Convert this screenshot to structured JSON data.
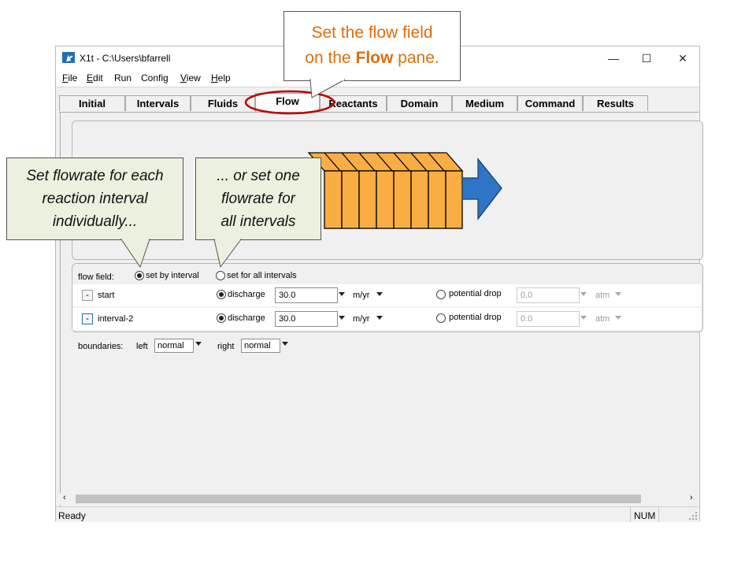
{
  "window": {
    "title": "X1t - C:\\Users\\bfarrell",
    "controls": [
      "—",
      "☐",
      "✕"
    ]
  },
  "menu": [
    {
      "label": "File",
      "u": "F",
      "rest": "ile"
    },
    {
      "label": "Edit",
      "u": "E",
      "rest": "dit"
    },
    {
      "label": "Run",
      "u": "",
      "rest": "Run"
    },
    {
      "label": "Config",
      "u": "",
      "rest": "Config"
    },
    {
      "label": "View",
      "u": "V",
      "rest": "iew"
    },
    {
      "label": "Help",
      "u": "H",
      "rest": "elp"
    }
  ],
  "tabs": [
    "Initial",
    "Intervals",
    "Fluids",
    "Flow",
    "Reactants",
    "Domain",
    "Medium",
    "Command",
    "Results"
  ],
  "active_tab": "Flow",
  "flow_field": {
    "label": "flow field:",
    "option_interval": "set by interval",
    "option_all": "set for all intervals",
    "selected": "set by interval"
  },
  "rows": [
    {
      "name": "start",
      "discharge_label": "discharge",
      "discharge_value": "30.0",
      "discharge_unit": "m/yr",
      "potential_label": "potential drop",
      "potential_value": "0.0",
      "potential_unit": "atm"
    },
    {
      "name": "interval-2",
      "discharge_label": "discharge",
      "discharge_value": "30.0",
      "discharge_unit": "m/yr",
      "potential_label": "potential drop",
      "potential_value": "0.0",
      "potential_unit": "atm"
    }
  ],
  "boundaries": {
    "label": "boundaries:",
    "left_label": "left",
    "left_value": "normal",
    "right_label": "right",
    "right_value": "normal"
  },
  "status": {
    "text": "Ready",
    "num": "NUM"
  },
  "callouts": {
    "top_line1": "Set the flow field",
    "top_line2_pre": "on the ",
    "top_line2_bold": "Flow",
    "top_line2_post": " pane.",
    "left_lines": [
      "Set flowrate for each",
      "reaction interval",
      "individually..."
    ],
    "right_lines": [
      "... or set one",
      "flowrate for",
      "all intervals"
    ]
  },
  "colors": {
    "accent_orange": "#e36c0a",
    "callout_bg": "#ebf1de",
    "block_fill": "#f9ad43",
    "arrow_fill": "#2e75c8",
    "highlight_red": "#c00000"
  }
}
